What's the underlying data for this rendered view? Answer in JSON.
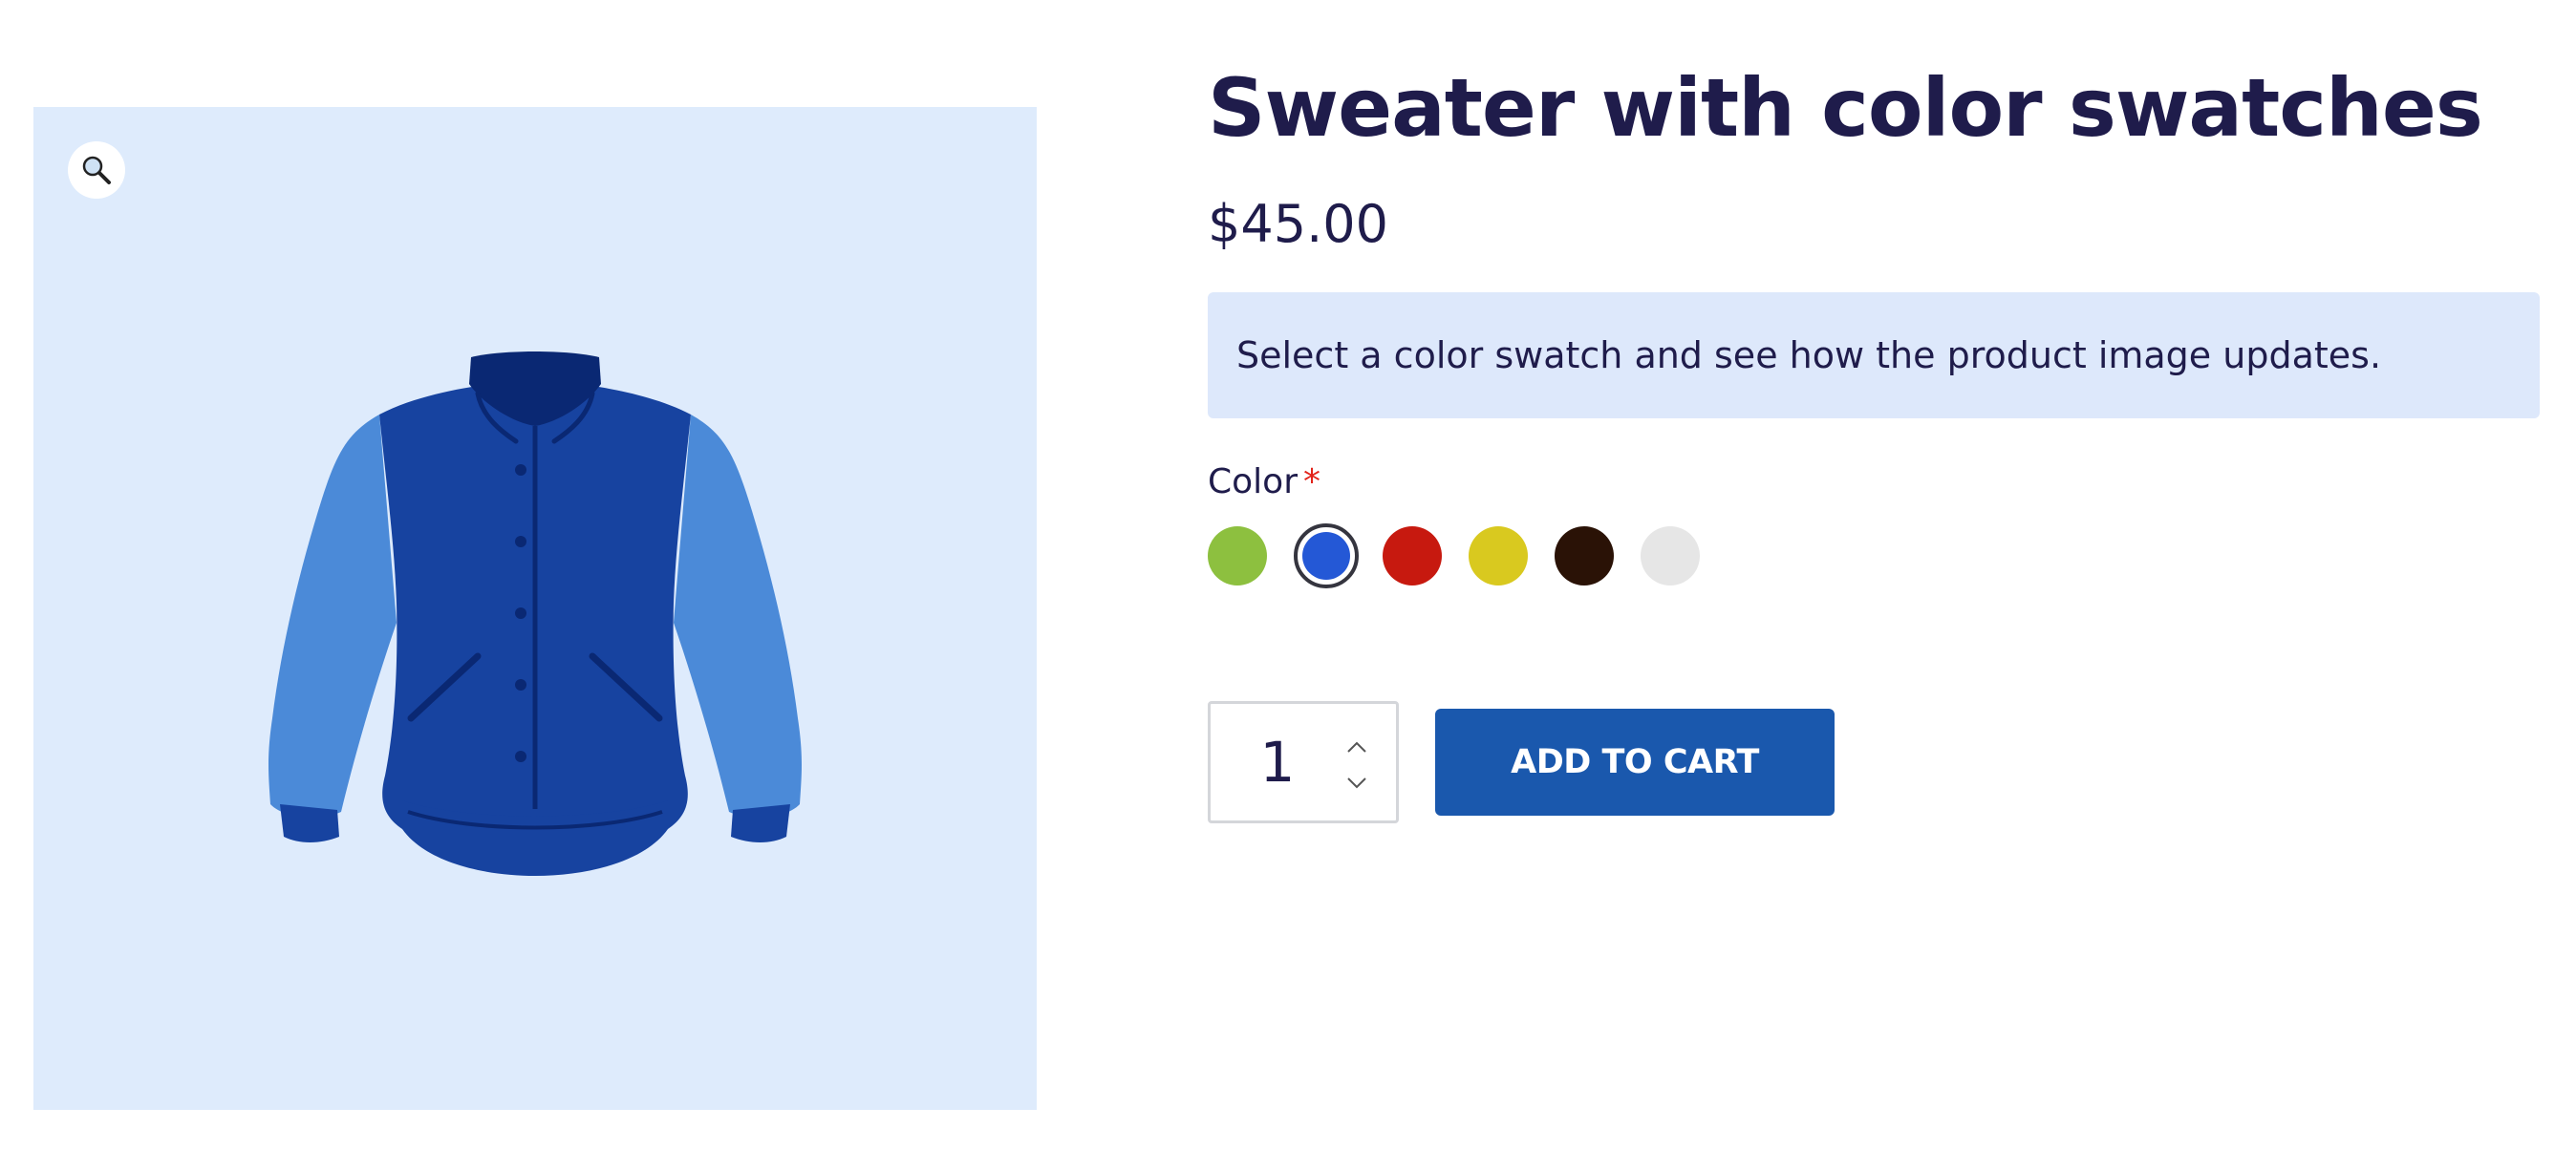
{
  "product": {
    "title": "Sweater with color swatches",
    "price": "$45.00",
    "notice": "Select a color swatch and see how the product image updates."
  },
  "gallery": {
    "zoom_icon": "magnifier-icon",
    "background_color": "#deebfc",
    "image": {
      "subject": "jacket",
      "body_color": "#1743a0",
      "sleeve_color": "#4b8ad8",
      "collar_color": "#0a2873"
    }
  },
  "variations": {
    "color_label": "Color",
    "required_mark": "*",
    "swatches": [
      {
        "name": "green",
        "color": "#8dc03f",
        "selected": false
      },
      {
        "name": "blue",
        "color": "#2458d6",
        "selected": true
      },
      {
        "name": "red",
        "color": "#c7190f",
        "selected": false
      },
      {
        "name": "yellow",
        "color": "#d9c91f",
        "selected": false
      },
      {
        "name": "dark-brown",
        "color": "#2a1206",
        "selected": false
      },
      {
        "name": "light-gray",
        "color": "#e6e6e6",
        "selected": false
      }
    ]
  },
  "cart": {
    "quantity": "1",
    "add_to_cart_label": "ADD TO CART",
    "button_color": "#1a58ad"
  }
}
